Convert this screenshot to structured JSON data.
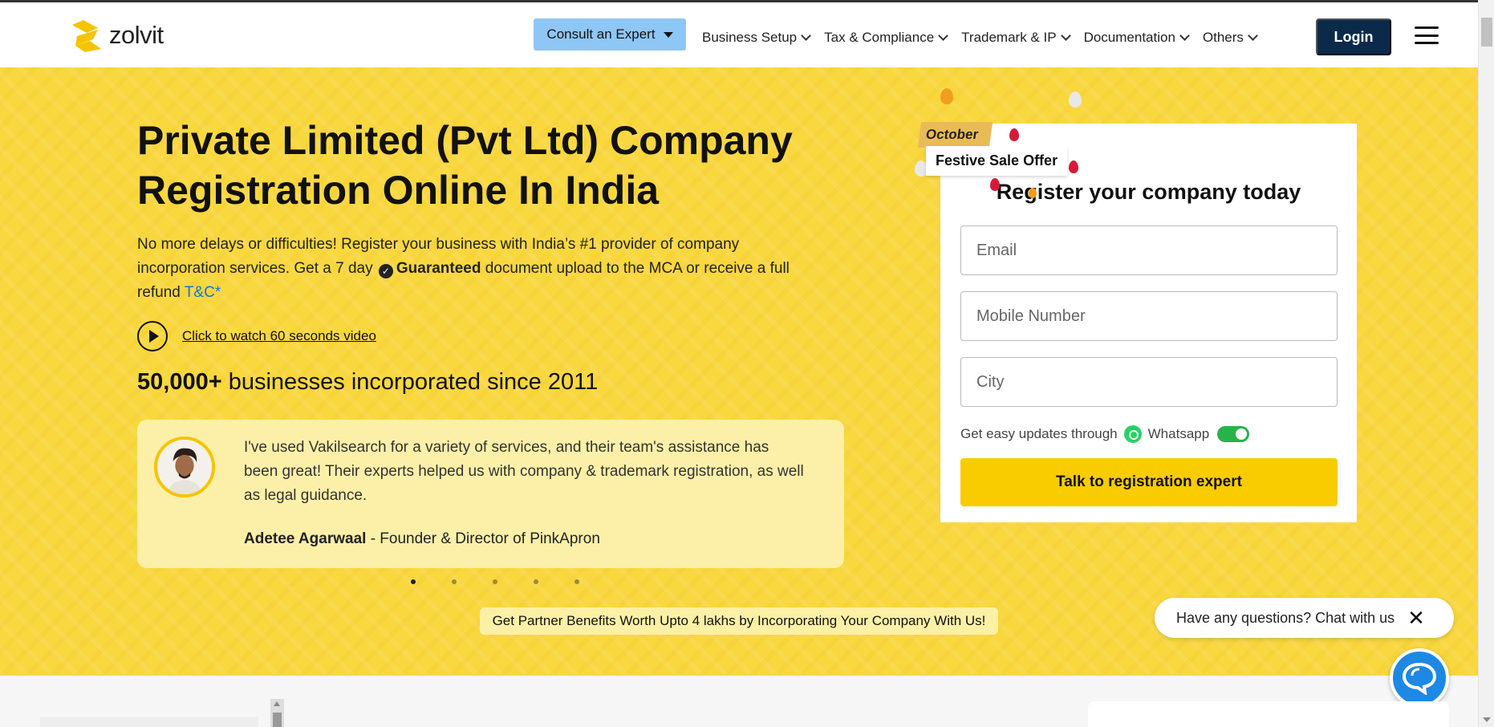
{
  "nav": {
    "logo_text": "zolvit",
    "consult_label": "Consult an Expert",
    "menu": [
      {
        "label": "Business Setup"
      },
      {
        "label": "Tax & Compliance"
      },
      {
        "label": "Trademark & IP"
      },
      {
        "label": "Documentation"
      },
      {
        "label": "Others"
      }
    ],
    "login_label": "Login"
  },
  "hero": {
    "title_line1": "Private Limited (Pvt Ltd) Company",
    "title_line2": "Registration Online In India",
    "desc_part1": "No more delays or difficulties! Register your business with India’s #1 provider of company incorporation services. Get a 7 day",
    "desc_bold": "Guaranteed",
    "desc_part2": "document upload to the MCA or receive a full refund",
    "tc_link": "T&C*",
    "video_link": "Click to watch 60 seconds video",
    "stats_bold": "50,000+",
    "stats_text": "businesses incorporated since 2011",
    "partner_bar": "Get Partner Benefits Worth Upto 4 lakhs by Incorporating Your Company With Us!"
  },
  "testimonial": {
    "quote": "I've used Vakilsearch for a variety of services, and their team's assistance has been great! Their experts helped us with company & trademark registration, as well as legal guidance.",
    "author_name": "Adetee Agarwaal",
    "author_role": "- Founder & Director of PinkApron",
    "dots": 5,
    "active_dot": 1
  },
  "festive": {
    "month": "October",
    "offer": "Festive Sale Offer"
  },
  "form": {
    "title": "Register your company today",
    "email_placeholder": "Email",
    "mobile_placeholder": "Mobile Number",
    "city_placeholder": "City",
    "updates_text": "Get easy updates through",
    "whatsapp_label": "Whatsapp",
    "whatsapp_toggle_on": true,
    "cta_label": "Talk to registration expert"
  },
  "chat": {
    "bubble_text": "Have any questions? Chat with us",
    "close_symbol": "✕"
  },
  "colors": {
    "hero_bg": "#f9d73f",
    "login_bg": "#0b2a4a",
    "consult_bg": "#8ec6f5",
    "cta_bg": "#f9cc00",
    "link": "#1a73c9"
  }
}
